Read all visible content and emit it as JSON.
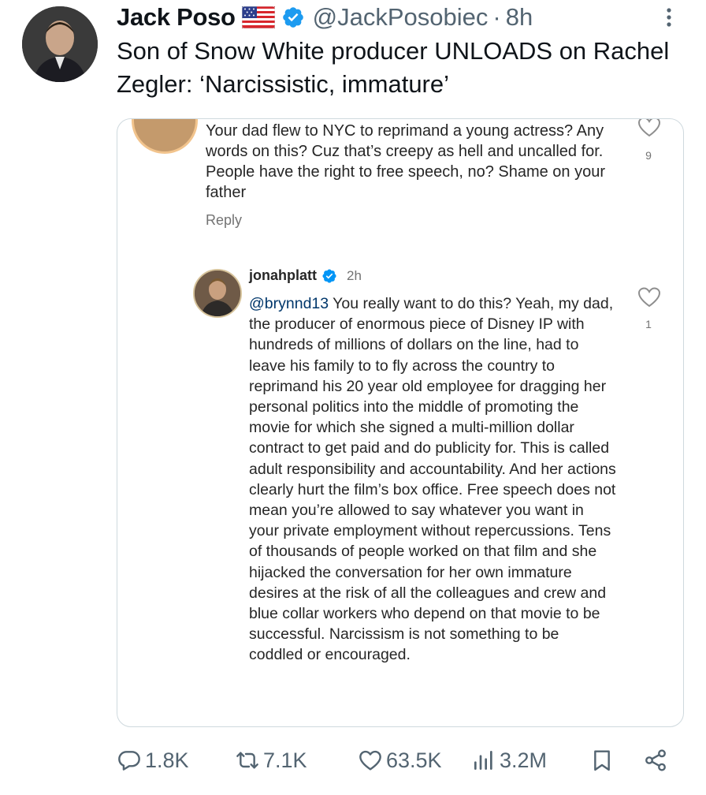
{
  "tweet": {
    "author_name": "Jack Poso",
    "handle": "@JackPosobiec",
    "separator": "·",
    "time": "8h",
    "text": "Son of Snow White producer UNLOADS on Rachel Zegler: ‘Narcissistic, immature’"
  },
  "embed": {
    "comment1": {
      "text": "Your dad flew to NYC to reprimand a young actress? Any words on this? Cuz that’s creepy as hell and uncalled for. People have the right to free speech, no? Shame on your father",
      "reply_label": "Reply",
      "likes": "9"
    },
    "comment2": {
      "username": "jonahplatt",
      "time": "2h",
      "mention": "@brynnd13",
      "text": " You really want to do this? Yeah, my dad, the producer of enormous piece of Disney IP with hundreds of millions of dollars on the line, had to leave his family to to fly across the country to reprimand his 20 year old employee for dragging her personal politics into the middle of promoting the movie for which she signed a multi-million dollar contract to get paid and do publicity for. This is called adult responsibility and accountability. And her actions clearly hurt the film’s box office. Free speech does not mean you’re allowed to say whatever you want in your private employment without repercussions. Tens of thousands of people worked on that film and she hijacked the conversation for her own immature desires at the risk of all the colleagues and crew and blue collar workers who depend on that movie to be successful. Narcissism is not something to be coddled or encouraged.",
      "likes": "1"
    }
  },
  "actions": {
    "replies": "1.8K",
    "reposts": "7.1K",
    "likes": "63.5K",
    "views": "3.2M"
  },
  "colors": {
    "text": "#0f1419",
    "muted": "#536471",
    "verified": "#1d9bf0",
    "border": "#cfd9de"
  }
}
